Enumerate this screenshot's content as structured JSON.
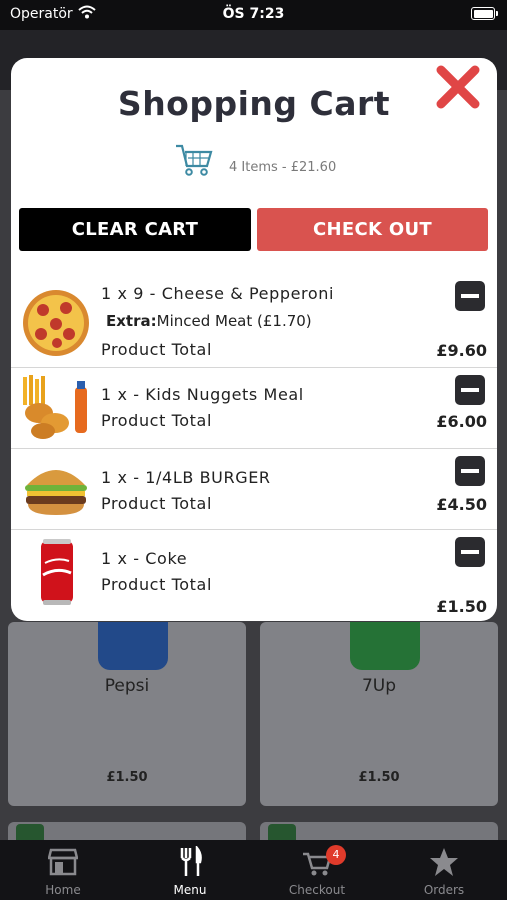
{
  "status_bar": {
    "carrier": "Operatör",
    "time": "ÖS 7:23"
  },
  "background": {
    "cards": [
      {
        "name": "Pepsi",
        "price": "£1.50",
        "can_color": "#2a5aa8"
      },
      {
        "name": "7Up",
        "price": "£1.50",
        "can_color": "#2e8b43"
      }
    ]
  },
  "modal": {
    "title": "Shopping Cart",
    "summary": "4 Items - £21.60",
    "clear_label": "CLEAR CART",
    "checkout_label": "CHECK OUT",
    "items": [
      {
        "title": "1 x 9 - Cheese & Pepperoni",
        "extra_label": "Extra:",
        "extra_value": "Minced Meat (£1.70)",
        "total_label": "Product Total",
        "price": "£9.60",
        "icon": "pizza-icon"
      },
      {
        "title": "1 x - Kids Nuggets Meal",
        "total_label": "Product Total",
        "price": "£6.00",
        "icon": "nuggets-meal-icon"
      },
      {
        "title": "1 x - 1/4LB BURGER",
        "total_label": "Product Total",
        "price": "£4.50",
        "icon": "burger-icon"
      },
      {
        "title": "1 x - Coke",
        "total_label": "Product Total",
        "price": "£1.50",
        "icon": "coke-can-icon"
      }
    ]
  },
  "tabbar": {
    "tabs": [
      {
        "label": "Home",
        "icon": "store-icon"
      },
      {
        "label": "Menu",
        "icon": "fork-knife-icon"
      },
      {
        "label": "Checkout",
        "icon": "cart-icon",
        "badge": "4"
      },
      {
        "label": "Orders",
        "icon": "star-icon"
      }
    ]
  },
  "colors": {
    "checkout": "#d9534f",
    "close": "#e04646",
    "badge": "#e03b2b",
    "text": "#222222"
  }
}
